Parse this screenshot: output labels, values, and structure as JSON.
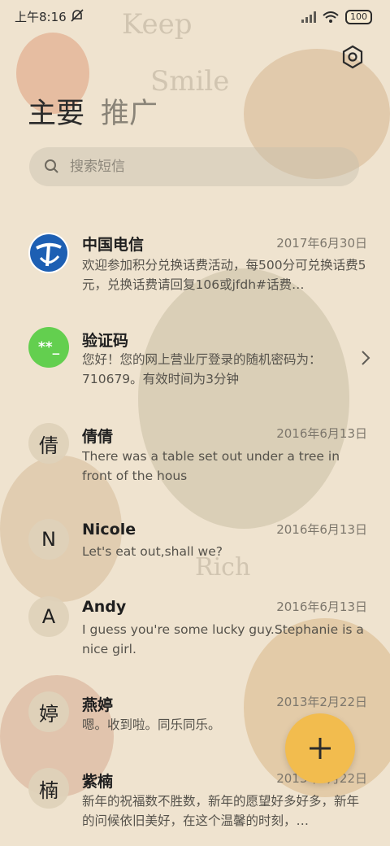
{
  "status_bar": {
    "time": "上午8:16",
    "battery": "100"
  },
  "tabs": [
    {
      "label": "主要"
    },
    {
      "label": "推广"
    }
  ],
  "search": {
    "placeholder": "搜索短信"
  },
  "conversations": [
    {
      "name": "中国电信",
      "date": "2017年6月30日",
      "preview": "欢迎参加积分兑换话费活动，每500分可兑换话费5元，兑换话费请回复106或jfdh#话费…",
      "avatar": "telecom-logo-icon"
    },
    {
      "name": "验证码",
      "date": "",
      "preview": "您好！您的网上营业厅登录的随机密码为：710679。有效时间为3分钟",
      "avatar_text": "**_"
    },
    {
      "name": "倩倩",
      "date": "2016年6月13日",
      "preview": "There was a table set out under a tree in front of the hous",
      "avatar_text": "倩"
    },
    {
      "name": "Nicole",
      "date": "2016年6月13日",
      "preview": "Let's eat out,shall we?",
      "avatar_text": "N"
    },
    {
      "name": "Andy",
      "date": "2016年6月13日",
      "preview": "I guess you're some lucky guy.Stephanie is a nice girl.",
      "avatar_text": "A"
    },
    {
      "name": "燕婷",
      "date": "2013年2月22日",
      "preview": "嗯。收到啦。同乐同乐。",
      "avatar_text": "婷"
    },
    {
      "name": "紫楠",
      "date": "2013年2月22日",
      "preview": "新年的祝福数不胜数，新年的愿望好多好多，新年的问候依旧美好，在这个温馨的时刻，…",
      "avatar_text": "楠"
    }
  ],
  "fab": {
    "icon": "plus-icon"
  },
  "colors": {
    "accent": "#f2bc4e",
    "verify_avatar": "#63cf4f",
    "telecom_blue": "#1d5fb3"
  }
}
